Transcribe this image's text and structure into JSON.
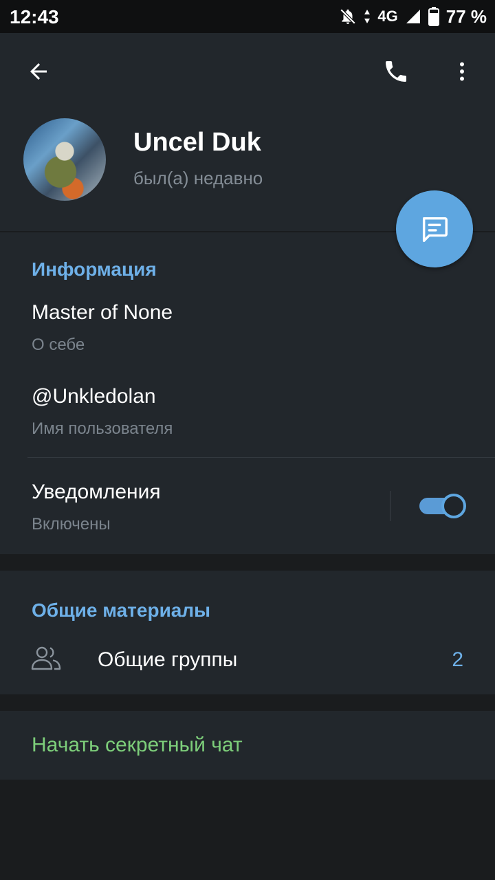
{
  "status_bar": {
    "time": "12:43",
    "network": "4G",
    "battery": "77 %"
  },
  "header": {
    "name": "Uncel Duk",
    "status": "был(а) недавно"
  },
  "info": {
    "title": "Информация",
    "bio_value": "Master of None",
    "bio_label": "О себе",
    "username_value": "@Unkledolan",
    "username_label": "Имя пользователя",
    "notifications_label": "Уведомления",
    "notifications_state": "Включены",
    "notifications_on": true
  },
  "shared": {
    "title": "Общие материалы",
    "groups_label": "Общие группы",
    "groups_count": "2"
  },
  "secret_chat": {
    "label": "Начать секретный чат"
  },
  "colors": {
    "accent": "#5ea6e0",
    "section_title": "#6eb0e8",
    "secret_chat": "#7dce7a",
    "card_bg": "#22272c",
    "page_bg": "#1a1c1e"
  }
}
